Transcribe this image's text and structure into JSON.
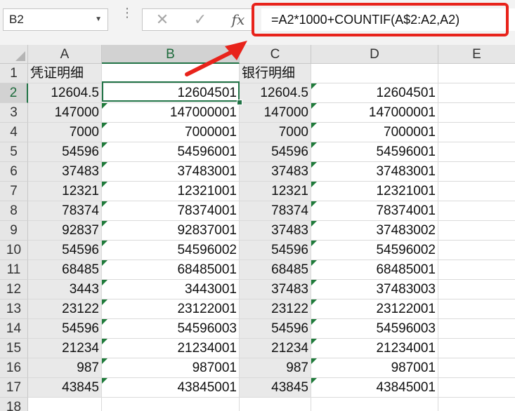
{
  "name_box": {
    "value": "B2"
  },
  "formula_bar": {
    "cancel_icon": "close-icon",
    "enter_icon": "check-icon",
    "fx_label": "fx",
    "formula": "=A2*1000+COUNTIF(A$2:A2,A2)"
  },
  "columns": [
    "A",
    "B",
    "C",
    "D",
    "E"
  ],
  "selected_cell": "B2",
  "highlight_color": "#e8231b",
  "accent_color": "#217346",
  "rows": [
    {
      "n": "1",
      "A": "凭证明细",
      "B": "",
      "C": "银行明细",
      "D": ""
    },
    {
      "n": "2",
      "A": "12604.5",
      "B": "12604501",
      "C": "12604.5",
      "D": "12604501"
    },
    {
      "n": "3",
      "A": "147000",
      "B": "147000001",
      "C": "147000",
      "D": "147000001"
    },
    {
      "n": "4",
      "A": "7000",
      "B": "7000001",
      "C": "7000",
      "D": "7000001"
    },
    {
      "n": "5",
      "A": "54596",
      "B": "54596001",
      "C": "54596",
      "D": "54596001"
    },
    {
      "n": "6",
      "A": "37483",
      "B": "37483001",
      "C": "37483",
      "D": "37483001"
    },
    {
      "n": "7",
      "A": "12321",
      "B": "12321001",
      "C": "12321",
      "D": "12321001"
    },
    {
      "n": "8",
      "A": "78374",
      "B": "78374001",
      "C": "78374",
      "D": "78374001"
    },
    {
      "n": "9",
      "A": "92837",
      "B": "92837001",
      "C": "37483",
      "D": "37483002"
    },
    {
      "n": "10",
      "A": "54596",
      "B": "54596002",
      "C": "54596",
      "D": "54596002"
    },
    {
      "n": "11",
      "A": "68485",
      "B": "68485001",
      "C": "68485",
      "D": "68485001"
    },
    {
      "n": "12",
      "A": "3443",
      "B": "3443001",
      "C": "37483",
      "D": "37483003"
    },
    {
      "n": "13",
      "A": "23122",
      "B": "23122001",
      "C": "23122",
      "D": "23122001"
    },
    {
      "n": "14",
      "A": "54596",
      "B": "54596003",
      "C": "54596",
      "D": "54596003"
    },
    {
      "n": "15",
      "A": "21234",
      "B": "21234001",
      "C": "21234",
      "D": "21234001"
    },
    {
      "n": "16",
      "A": "987",
      "B": "987001",
      "C": "987",
      "D": "987001"
    },
    {
      "n": "17",
      "A": "43845",
      "B": "43845001",
      "C": "43845",
      "D": "43845001"
    },
    {
      "n": "18",
      "A": "",
      "B": "",
      "C": "",
      "D": ""
    }
  ]
}
